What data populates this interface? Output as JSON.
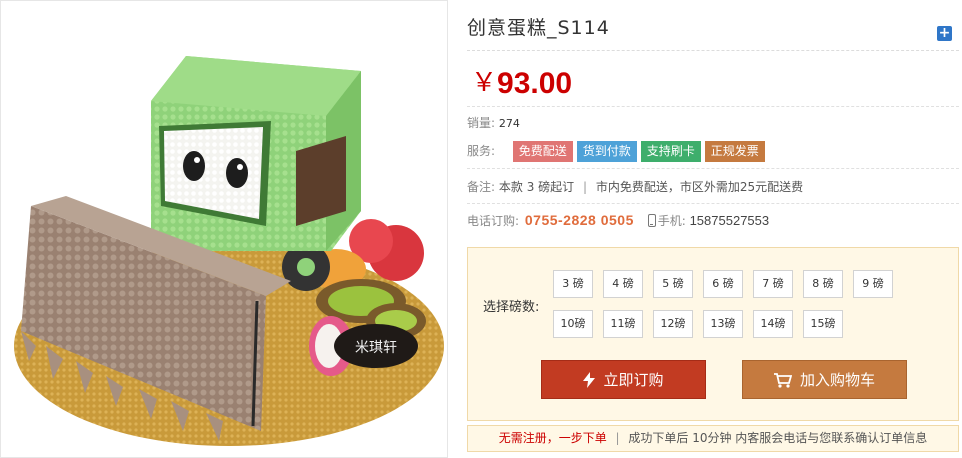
{
  "product": {
    "title": "创意蛋糕_S114",
    "price_symbol": "￥",
    "price": "93.00",
    "image_watermark": "米琪轩"
  },
  "sales": {
    "label": "销量:",
    "value": "274"
  },
  "service": {
    "label": "服务:",
    "tags": [
      {
        "text": "免费配送",
        "color": "#e07573"
      },
      {
        "text": "货到付款",
        "color": "#4ea2d8"
      },
      {
        "text": "支持刷卡",
        "color": "#3eae6c"
      },
      {
        "text": "正规发票",
        "color": "#c57a3f"
      }
    ]
  },
  "note": {
    "label": "备注:",
    "text1": "本款 3 磅起订",
    "separator": "|",
    "text2": "市内免费配送，市区外需加25元配送费"
  },
  "phone": {
    "label": "电话订购:",
    "number": "0755-2828 0505",
    "mobile_label": "手机:",
    "mobile": "15875527553"
  },
  "options": {
    "label": "选择磅数:",
    "sizes_row1": [
      "3 磅",
      "4 磅",
      "5 磅",
      "6 磅",
      "7 磅",
      "8 磅",
      "9 磅"
    ],
    "sizes_row2": [
      "10磅",
      "11磅",
      "12磅",
      "13磅",
      "14磅",
      "15磅"
    ]
  },
  "actions": {
    "order_label": "立即订购",
    "cart_label": "加入购物车"
  },
  "tip": {
    "red_text": "无需注册，一步下单",
    "separator": "|",
    "text": "成功下单后 10分钟 内客服会电话与您联系确认订单信息"
  },
  "icons": [
    "plus-icon",
    "lightning-icon",
    "cart-icon",
    "mobile-phone-icon"
  ]
}
